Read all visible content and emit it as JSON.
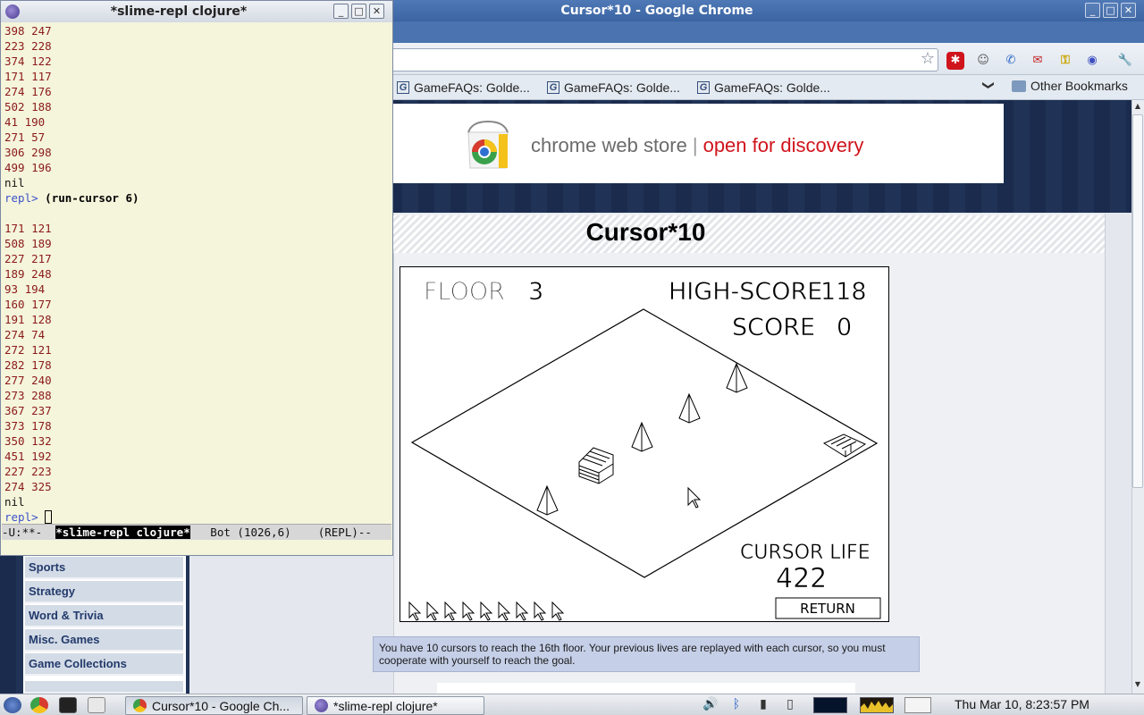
{
  "chrome": {
    "title": "Cursor*10 - Google Chrome",
    "bookmarks": [
      "GameFAQs: Golde...",
      "GameFAQs: Golde...",
      "GameFAQs: Golde..."
    ],
    "other_bookmarks": "Other Bookmarks",
    "chevron": "❯",
    "star_icon": "☆"
  },
  "banner": {
    "text1": "chrome web store",
    "separator": "|",
    "text2": "open for discovery"
  },
  "sidebar": {
    "items": [
      {
        "label": "Sports"
      },
      {
        "label": "Strategy"
      },
      {
        "label": "Word & Trivia"
      },
      {
        "label": "Misc. Games"
      },
      {
        "label": "Game Collections"
      }
    ]
  },
  "game": {
    "title": "Cursor*10",
    "floor_label": "FLOOR",
    "floor_value": "3",
    "high_score_label": "HIGH-SCORE",
    "high_score_value": "118",
    "score_label": "SCORE",
    "score_value": "0",
    "cursor_life_label": "CURSOR LIFE",
    "cursor_life_value": "422",
    "return_label": "RETURN",
    "cursors_remaining": 9,
    "description": "You have 10 cursors to reach the 16th floor. Your previous lives are replayed with each cursor, so you must cooperate with yourself to reach the goal."
  },
  "emacs": {
    "title": "*slime-repl clojure*",
    "output_block_1": [
      "398 247",
      "223 228",
      "374 122",
      "171 117",
      "274 176",
      "502 188",
      "41 190",
      "271 57",
      "306 298",
      "499 196"
    ],
    "nil_1": "nil",
    "prompt": "repl>",
    "command": "(run-cursor 6)",
    "output_block_2": [
      "171 121",
      "508 189",
      "227 217",
      "189 248",
      "93 194",
      "160 177",
      "191 128",
      "274 74",
      "272 121",
      "282 178",
      "277 240",
      "273 288",
      "367 237",
      "373 178",
      "350 132",
      "451 192",
      "227 223",
      "274 325"
    ],
    "nil_2": "nil",
    "modeline_left": "-U:**-  ",
    "modeline_buffer": "*slime-repl clojure*",
    "modeline_right": "   Bot (1026,6)    (REPL)--"
  },
  "taskbar": {
    "tasks": [
      {
        "label": "Cursor*10 - Google Ch..."
      },
      {
        "label": "*slime-repl clojure*"
      }
    ],
    "clock": "Thu Mar 10,  8:23:57 PM"
  },
  "colors": {
    "chrome_titlebar": "#4f79b6",
    "emacs_bg": "#f5f5dc",
    "repl_output": "#8b1a1a",
    "repl_prompt": "#3c52c8",
    "accent_red": "#d0141c",
    "page_navy": "#1d2d4f"
  }
}
